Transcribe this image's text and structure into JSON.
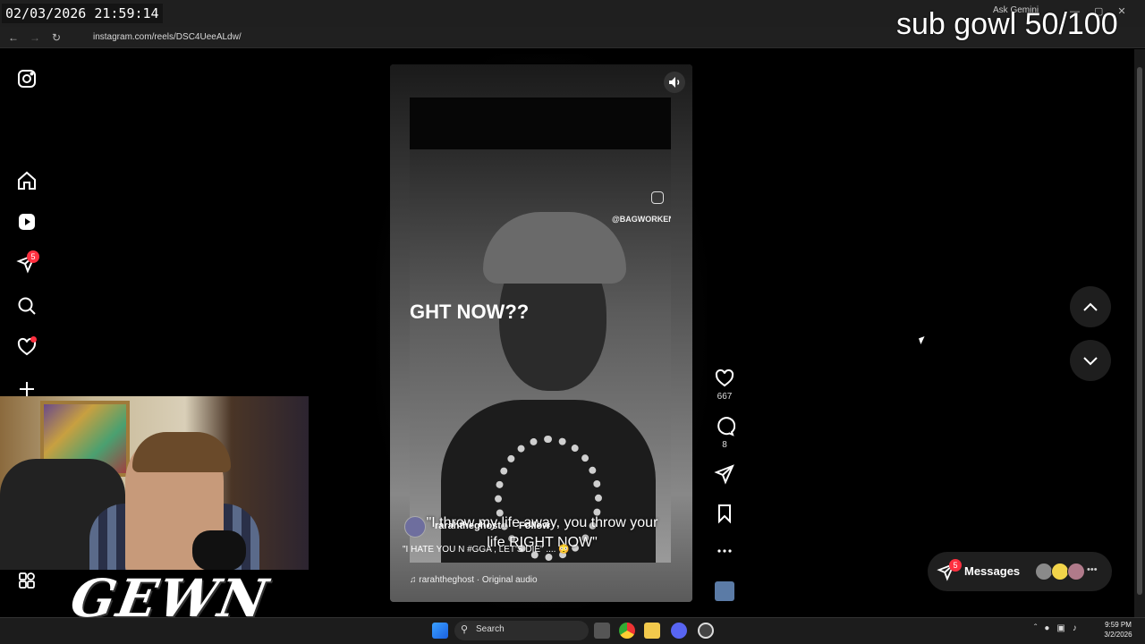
{
  "stream_overlay": {
    "timestamp": "02/03/2026 21:59:14",
    "goal_text": "sub gowl 50/100",
    "brand": "GEWN"
  },
  "browser": {
    "url": "instagram.com/reels/DSC4UeeALdw/",
    "gemini_label": "Ask Gemini"
  },
  "sidebar": {
    "items": [
      {
        "name": "instagram-logo"
      },
      {
        "name": "home"
      },
      {
        "name": "reels"
      },
      {
        "name": "messages",
        "badge": "5"
      },
      {
        "name": "search"
      },
      {
        "name": "notifications"
      },
      {
        "name": "create"
      },
      {
        "name": "more"
      }
    ]
  },
  "reel": {
    "video_caption": "GHT NOW??",
    "watermark": "@BAGWORKENT",
    "subtitle": "\"I throw my life away, you throw your life RIGHT NOW\"",
    "author": "rarahtheghost",
    "follow_sep": "·",
    "follow_label": "Follow",
    "caption": "\"I HATE YOU N #GGA , LET'S DIE\" .... 😳",
    "audio": "rarahtheghost · Original audio",
    "likes": "667",
    "comments": "8"
  },
  "messages": {
    "label": "Messages",
    "badge": "5",
    "avatar_colors": [
      "#8a8a8a",
      "#f2d44a",
      "#b07a8a"
    ]
  },
  "taskbar": {
    "search_label": "Search",
    "time": "9:59 PM",
    "date": "3/2/2026"
  },
  "colors": {
    "badge": "#ff3040",
    "background": "#000000"
  }
}
